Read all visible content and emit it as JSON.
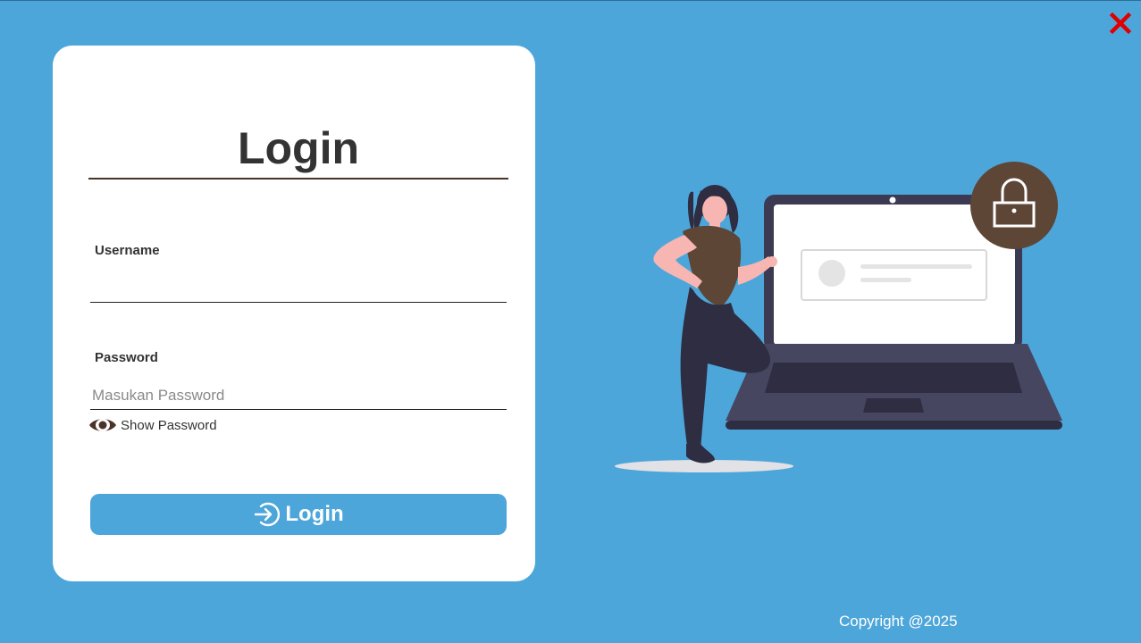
{
  "colors": {
    "background": "#4da6da",
    "card": "#ffffff",
    "close": "#e00000",
    "accent_brown": "#5e4637",
    "button": "#4da6da"
  },
  "window": {
    "close_icon": "close-icon"
  },
  "login": {
    "title": "Login",
    "username_label": "Username",
    "username_value": "",
    "username_placeholder": "",
    "password_label": "Password",
    "password_value": "",
    "password_placeholder": "Masukan Password",
    "show_password_icon": "eye-icon",
    "show_password_label": "Show Password",
    "button_icon": "sign-in-icon",
    "button_label": "Login"
  },
  "illustration": {
    "icons": [
      "woman-figure",
      "laptop-icon",
      "padlock-icon"
    ]
  },
  "footer": {
    "copyright": "Copyright @2025"
  }
}
